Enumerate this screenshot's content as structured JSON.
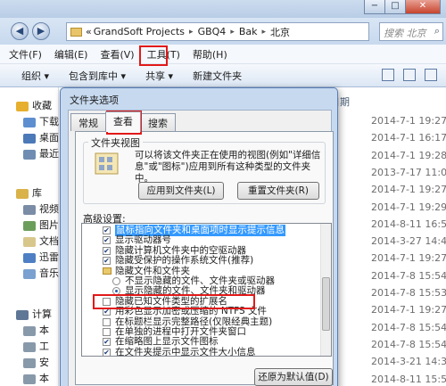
{
  "window": {
    "controls": [
      "−",
      "□",
      "✕"
    ]
  },
  "address": {
    "prefix": "«",
    "crumbs": [
      "GrandSoft Projects",
      "GBQ4",
      "Bak",
      "北京"
    ],
    "search_placeholder": "搜索 北京"
  },
  "menu": [
    "文件(F)",
    "编辑(E)",
    "查看(V)",
    "工具(T)",
    "帮助(H)"
  ],
  "toolbar": [
    "组织 ▾",
    "包含到库中 ▾",
    "共享 ▾",
    "新建文件夹"
  ],
  "nav": [
    {
      "label": "收藏",
      "icon": "star-icon",
      "color": "#e6b02e"
    },
    {
      "label": "下载",
      "icon": "download-folder-icon",
      "color": "#5d8fd0"
    },
    {
      "label": "桌面",
      "icon": "desktop-icon",
      "color": "#4c79b8"
    },
    {
      "label": "最近",
      "icon": "recent-icon",
      "color": "#6f8db3"
    },
    {
      "label": "库",
      "icon": "library-icon",
      "color": "#d9b24a"
    },
    {
      "label": "视频",
      "icon": "video-icon",
      "color": "#7a8ca6"
    },
    {
      "label": "图片",
      "icon": "picture-icon",
      "color": "#6c9e5b"
    },
    {
      "label": "文档",
      "icon": "document-icon",
      "color": "#d8c78b"
    },
    {
      "label": "迅雷",
      "icon": "thunder-icon",
      "color": "#4e7fc4"
    },
    {
      "label": "音乐",
      "icon": "music-icon",
      "color": "#7aa1cf"
    },
    {
      "label": "计算",
      "icon": "computer-icon",
      "color": "#5f7796"
    },
    {
      "label": "本",
      "icon": "drive-icon",
      "color": "#8899aa"
    },
    {
      "label": "工",
      "icon": "drive-icon",
      "color": "#8899aa"
    },
    {
      "label": "安",
      "icon": "drive-icon",
      "color": "#8899aa"
    },
    {
      "label": "本",
      "icon": "drive-icon",
      "color": "#8899aa"
    }
  ],
  "filelist": {
    "column_header": "修改日期",
    "dates": [
      "2014-7-1 19:27",
      "2014-7-1 16:17",
      "2014-7-1 19:28",
      "2013-7-17 11:03",
      "2014-7-1 19:27",
      "2014-7-1 19:29",
      "2014-8-11 16:50",
      "2014-3-27 14:44",
      "2014-7-1 19:27",
      "2014-7-8 15:54",
      "2014-7-8 15:53",
      "2014-7-1 19:27",
      "2014-7-8 15:54",
      "2014-7-8 15:54",
      "2014-3-21 14:36",
      "2014-8-11 15:53"
    ]
  },
  "dialog": {
    "title": "文件夹选项",
    "tabs": [
      "常规",
      "查看",
      "搜索"
    ],
    "folder_view": {
      "legend": "文件夹视图",
      "description": "可以将该文件夹正在使用的视图(例如\"详细信息\"或\"图标\")应用到所有这种类型的文件夹中。",
      "apply_button": "应用到文件夹(L)",
      "reset_button": "重置文件夹(R)"
    },
    "advanced_label": "高级设置:",
    "settings": [
      {
        "kind": "checkbox",
        "checked": true,
        "label": "鼠标指向文件夹和桌面项时显示提示信息",
        "indent": 0,
        "selected": true
      },
      {
        "kind": "checkbox",
        "checked": true,
        "label": "显示驱动器号",
        "indent": 0
      },
      {
        "kind": "checkbox",
        "checked": true,
        "label": "隐藏计算机文件夹中的空驱动器",
        "indent": 0
      },
      {
        "kind": "checkbox",
        "checked": true,
        "label": "隐藏受保护的操作系统文件(推荐)",
        "indent": 0
      },
      {
        "kind": "folder",
        "label": "隐藏文件和文件夹",
        "indent": 0
      },
      {
        "kind": "radio",
        "checked": false,
        "label": "不显示隐藏的文件、文件夹或驱动器",
        "indent": 1
      },
      {
        "kind": "radio",
        "checked": true,
        "label": "显示隐藏的文件、文件夹和驱动器",
        "indent": 1
      },
      {
        "kind": "checkbox",
        "checked": false,
        "label": "隐藏已知文件类型的扩展名",
        "indent": 0
      },
      {
        "kind": "checkbox",
        "checked": true,
        "label": "用彩色显示加密或压缩的 NTFS 文件",
        "indent": 0
      },
      {
        "kind": "checkbox",
        "checked": false,
        "label": "在标题栏显示完整路径(仅限经典主题)",
        "indent": 0
      },
      {
        "kind": "checkbox",
        "checked": false,
        "label": "在单独的进程中打开文件夹窗口",
        "indent": 0
      },
      {
        "kind": "checkbox",
        "checked": true,
        "label": "在缩略图上显示文件图标",
        "indent": 0
      },
      {
        "kind": "checkbox",
        "checked": true,
        "label": "在文件夹提示中显示文件大小信息",
        "indent": 0
      }
    ],
    "restore_button": "还原为默认值(D)"
  },
  "colors": {
    "highlight_red": "#e21919",
    "selection_blue": "#3399ff"
  }
}
